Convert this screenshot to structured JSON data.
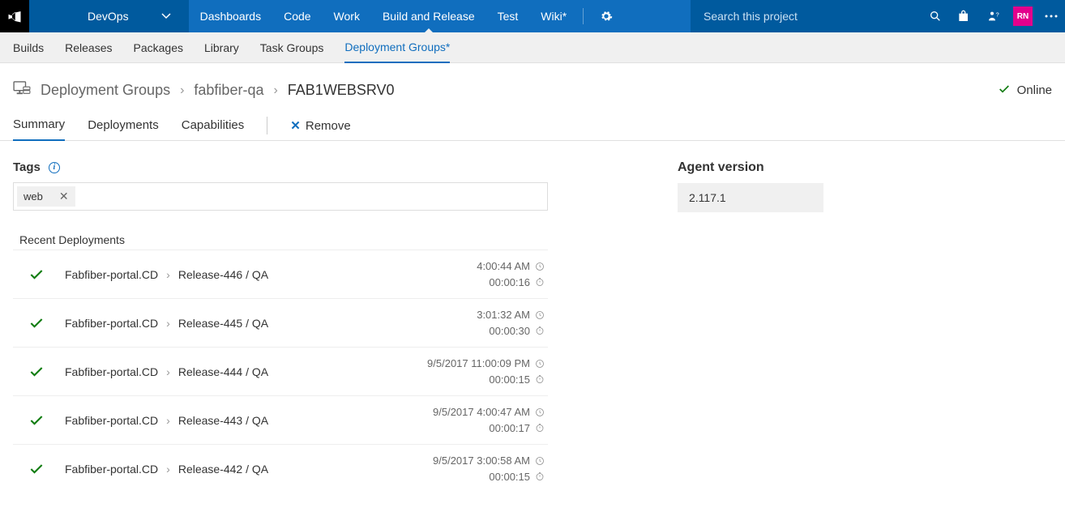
{
  "project_name": "DevOps",
  "topnav": {
    "items": [
      "Dashboards",
      "Code",
      "Work",
      "Build and Release",
      "Test",
      "Wiki*"
    ],
    "active_index": 3
  },
  "search": {
    "placeholder": "Search this project"
  },
  "avatar_initials": "RN",
  "subnav": {
    "items": [
      "Builds",
      "Releases",
      "Packages",
      "Library",
      "Task Groups",
      "Deployment Groups*"
    ],
    "active_index": 5
  },
  "breadcrumb": {
    "root": "Deployment Groups",
    "group": "fabfiber-qa",
    "target": "FAB1WEBSRV0"
  },
  "status": {
    "label": "Online"
  },
  "pagetabs": {
    "items": [
      "Summary",
      "Deployments",
      "Capabilities"
    ],
    "active_index": 0,
    "remove_label": "Remove"
  },
  "tags": {
    "heading": "Tags",
    "chips": [
      "web"
    ]
  },
  "recent_heading": "Recent Deployments",
  "deployments": [
    {
      "pipeline": "Fabfiber-portal.CD",
      "release": "Release-446 / QA",
      "time": "4:00:44 AM",
      "duration": "00:00:16"
    },
    {
      "pipeline": "Fabfiber-portal.CD",
      "release": "Release-445 / QA",
      "time": "3:01:32 AM",
      "duration": "00:00:30"
    },
    {
      "pipeline": "Fabfiber-portal.CD",
      "release": "Release-444 / QA",
      "time": "9/5/2017 11:00:09 PM",
      "duration": "00:00:15"
    },
    {
      "pipeline": "Fabfiber-portal.CD",
      "release": "Release-443 / QA",
      "time": "9/5/2017 4:00:47 AM",
      "duration": "00:00:17"
    },
    {
      "pipeline": "Fabfiber-portal.CD",
      "release": "Release-442 / QA",
      "time": "9/5/2017 3:00:58 AM",
      "duration": "00:00:15"
    }
  ],
  "agent": {
    "heading": "Agent version",
    "version": "2.117.1"
  }
}
